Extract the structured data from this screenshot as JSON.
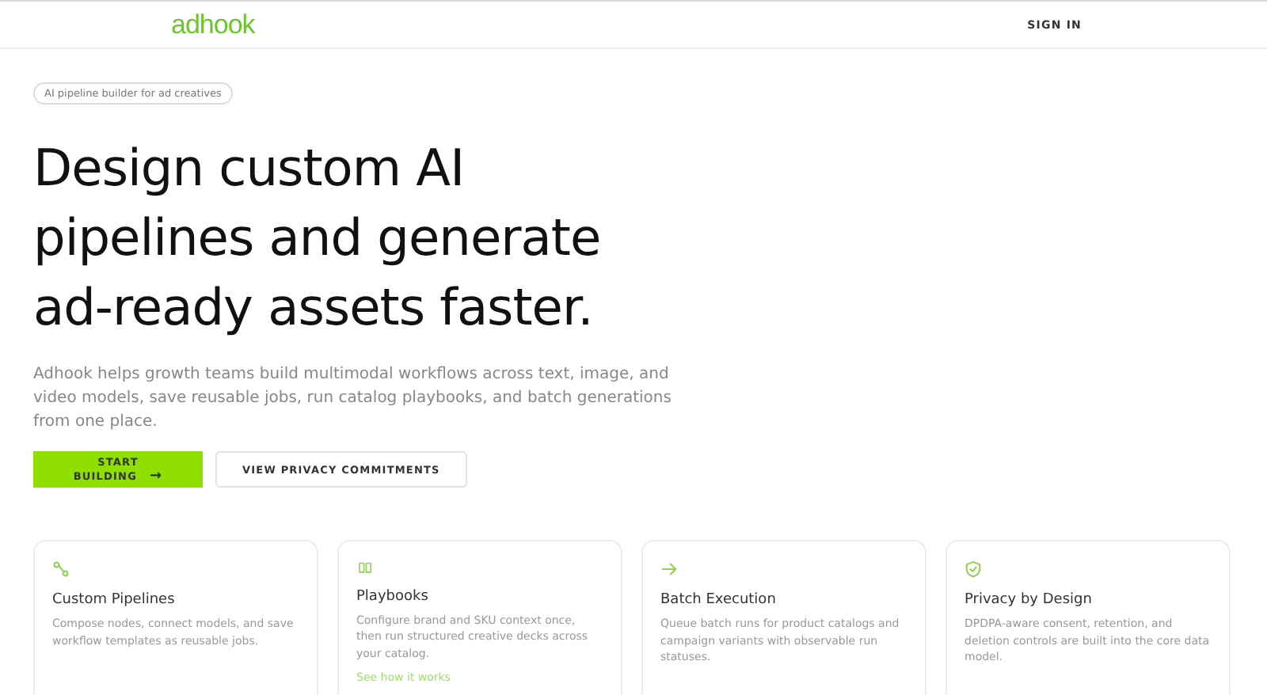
{
  "header": {
    "logo": "adhook",
    "nav": "SIGN IN"
  },
  "hero": {
    "badge": "AI pipeline builder for ad creatives",
    "headline": [
      "Design custom AI",
      "pipelines and generate",
      "ad-ready assets faster."
    ],
    "description": "Adhook helps growth teams build multimodal workflows across text, image, and video models, save reusable jobs, run catalog playbooks, and batch generations from one place.",
    "buttons": [
      {
        "label": "START BUILDING",
        "kind": "primary",
        "arrow": "→"
      },
      {
        "label": "VIEW PRIVACY COMMITMENTS",
        "kind": "secondary"
      }
    ]
  },
  "features": [
    {
      "kind": "route",
      "title": "Custom Pipelines",
      "text": "Compose nodes, connect models, and save workflow templates as reusable jobs."
    },
    {
      "kind": "book",
      "title": "Playbooks",
      "text": "Configure brand and SKU context once, then run structured creative decks across your catalog.",
      "link": "See how it works"
    },
    {
      "kind": "arrow",
      "title": "Batch Execution",
      "text": "Queue batch runs for product catalogs and campaign variants with observable run statuses."
    },
    {
      "kind": "shield",
      "title": "Privacy by Design",
      "text": "DPDPA-aware consent, retention, and deletion controls are built into the core data model."
    }
  ]
}
